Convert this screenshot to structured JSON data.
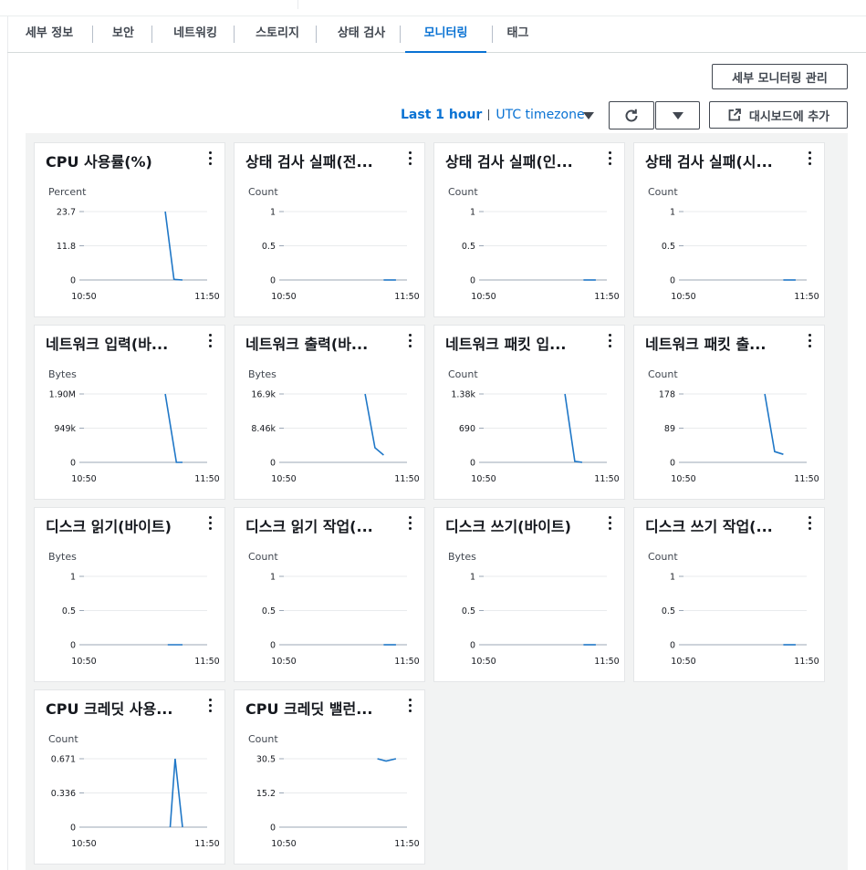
{
  "tabs": [
    {
      "label": "세부 정보",
      "active": false
    },
    {
      "label": "보안",
      "active": false
    },
    {
      "label": "네트워킹",
      "active": false
    },
    {
      "label": "스토리지",
      "active": false
    },
    {
      "label": "상태 검사",
      "active": false
    },
    {
      "label": "모니터링",
      "active": true
    },
    {
      "label": "태그",
      "active": false
    }
  ],
  "toolbar": {
    "detail_monitoring_label": "세부 모니터링 관리",
    "time_range": "Last 1 hour",
    "timezone": "UTC timezone",
    "add_dashboard_label": "대시보드에 추가"
  },
  "colors": {
    "accent": "#0972d3",
    "line": "#1f77c7"
  },
  "x_ticks": [
    "10:50",
    "11:50"
  ],
  "charts": [
    {
      "title": "CPU 사용률(%)",
      "unit": "Percent",
      "ticks": [
        "23.7",
        "11.8",
        "0"
      ],
      "ymax": 23.7,
      "series": [
        [
          0.66,
          23.7
        ],
        [
          0.73,
          0.3
        ],
        [
          0.74,
          0.2
        ],
        [
          0.8,
          0.0
        ]
      ]
    },
    {
      "title": "상태 검사 실패(전...",
      "unit": "Count",
      "ticks": [
        "1",
        "0.5",
        "0"
      ],
      "ymax": 1,
      "series": [
        [
          0.81,
          0
        ],
        [
          0.91,
          0
        ]
      ]
    },
    {
      "title": "상태 검사 실패(인...",
      "unit": "Count",
      "ticks": [
        "1",
        "0.5",
        "0"
      ],
      "ymax": 1,
      "series": [
        [
          0.81,
          0
        ],
        [
          0.91,
          0
        ]
      ]
    },
    {
      "title": "상태 검사 실패(시...",
      "unit": "Count",
      "ticks": [
        "1",
        "0.5",
        "0"
      ],
      "ymax": 1,
      "series": [
        [
          0.81,
          0
        ],
        [
          0.91,
          0
        ]
      ]
    },
    {
      "title": "네트워크 입력(바...",
      "unit": "Bytes",
      "ticks": [
        "1.90M",
        "949k",
        "0"
      ],
      "ymax": 1.9,
      "series": [
        [
          0.66,
          1.9
        ],
        [
          0.75,
          0.0
        ],
        [
          0.8,
          0.0
        ]
      ]
    },
    {
      "title": "네트워크 출력(바...",
      "unit": "Bytes",
      "ticks": [
        "16.9k",
        "8.46k",
        "0"
      ],
      "ymax": 16.9,
      "series": [
        [
          0.66,
          16.9
        ],
        [
          0.74,
          3.6
        ],
        [
          0.81,
          1.8
        ]
      ]
    },
    {
      "title": "네트워크 패킷 입...",
      "unit": "Count",
      "ticks": [
        "1.38k",
        "690",
        "0"
      ],
      "ymax": 1.38,
      "series": [
        [
          0.66,
          1.38
        ],
        [
          0.74,
          0.02
        ],
        [
          0.8,
          0.0
        ]
      ]
    },
    {
      "title": "네트워크 패킷 출...",
      "unit": "Count",
      "ticks": [
        "178",
        "89",
        "0"
      ],
      "ymax": 178,
      "series": [
        [
          0.66,
          178
        ],
        [
          0.74,
          28
        ],
        [
          0.81,
          21
        ]
      ]
    },
    {
      "title": "디스크 읽기(바이트)",
      "unit": "Bytes",
      "ticks": [
        "1",
        "0.5",
        "0"
      ],
      "ymax": 1,
      "series": [
        [
          0.68,
          0
        ],
        [
          0.8,
          0
        ]
      ]
    },
    {
      "title": "디스크 읽기 작업(...",
      "unit": "Count",
      "ticks": [
        "1",
        "0.5",
        "0"
      ],
      "ymax": 1,
      "series": [
        [
          0.81,
          0
        ],
        [
          0.91,
          0
        ]
      ]
    },
    {
      "title": "디스크 쓰기(바이트)",
      "unit": "Bytes",
      "ticks": [
        "1",
        "0.5",
        "0"
      ],
      "ymax": 1,
      "series": [
        [
          0.81,
          0
        ],
        [
          0.91,
          0
        ]
      ]
    },
    {
      "title": "디스크 쓰기 작업(...",
      "unit": "Count",
      "ticks": [
        "1",
        "0.5",
        "0"
      ],
      "ymax": 1,
      "series": [
        [
          0.81,
          0
        ],
        [
          0.91,
          0
        ]
      ]
    },
    {
      "title": "CPU 크레딧 사용...",
      "unit": "Count",
      "ticks": [
        "0.671",
        "0.336",
        "0"
      ],
      "ymax": 0.671,
      "series": [
        [
          0.7,
          0
        ],
        [
          0.74,
          0.671
        ],
        [
          0.8,
          0
        ]
      ]
    },
    {
      "title": "CPU 크레딧 밸런...",
      "unit": "Count",
      "ticks": [
        "30.5",
        "15.2",
        "0"
      ],
      "ymax": 30.5,
      "series": [
        [
          0.76,
          30.5
        ],
        [
          0.83,
          29.5
        ],
        [
          0.91,
          30.5
        ]
      ]
    }
  ]
}
